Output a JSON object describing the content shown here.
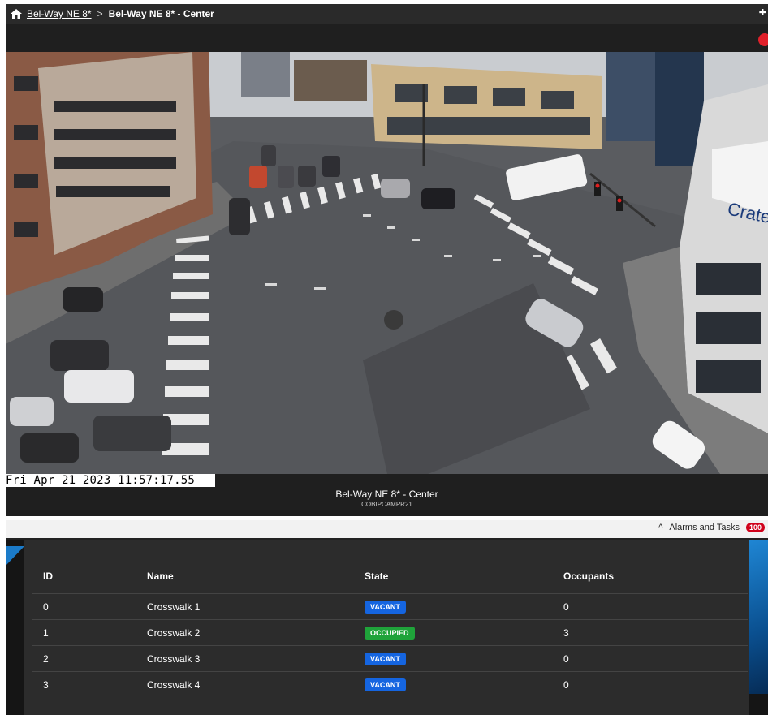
{
  "breadcrumb": {
    "parent": "Bel-Way NE 8*",
    "separator": ">",
    "current": "Bel-Way NE 8* - Center"
  },
  "video": {
    "timestamp": "Fri Apr 21 2023 11:57:17.55",
    "camera_title": "Bel-Way NE 8* - Center",
    "camera_id": "COBIPCAMPR21"
  },
  "alarms": {
    "label": "Alarms and Tasks",
    "count": "100"
  },
  "table": {
    "headers": [
      "ID",
      "Name",
      "State",
      "Occupants"
    ],
    "rows": [
      {
        "id": "0",
        "name": "Crosswalk 1",
        "state": "VACANT",
        "occupants": "0"
      },
      {
        "id": "1",
        "name": "Crosswalk 2",
        "state": "OCCUPIED",
        "occupants": "3"
      },
      {
        "id": "2",
        "name": "Crosswalk 3",
        "state": "VACANT",
        "occupants": "0"
      },
      {
        "id": "3",
        "name": "Crosswalk 4",
        "state": "VACANT",
        "occupants": "0"
      }
    ]
  },
  "colors": {
    "vacant": "#1565e0",
    "occupied": "#1fa33a",
    "alarm_badge": "#d0021b"
  }
}
